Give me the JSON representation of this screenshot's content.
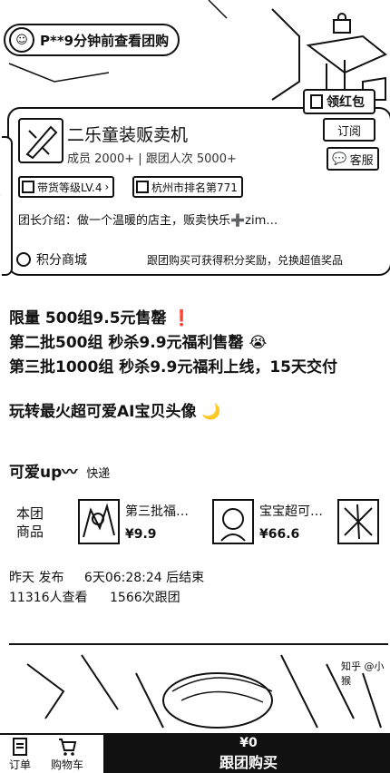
{
  "banner": {
    "notice": "P**9分钟前查看团购"
  },
  "shop": {
    "red_packet": "领红包",
    "name": "二乐童装贩卖机",
    "stats": "成员 2000+ | 跟团人次 5000+",
    "follow": "订阅",
    "service": "客服",
    "badge_level": "带货等级LV.4",
    "badge_rank": "杭州市排名第771",
    "intro": "团长介绍：做一个温暖的店主，贩卖快乐➕zim…",
    "mall": "积分商城",
    "mall_tip": "跟团购买可获得积分奖励，兑换超值奖品"
  },
  "post": {
    "line1": "限量 500组9.5元售罄 ❗",
    "line2": "第二批500组 秒杀9.9元福利售罄 😭",
    "line3": "第三批1000组 秒杀9.9元福利上线，15天交付",
    "line4": "玩转最火超可爱AI宝贝头像 🌙"
  },
  "topic": {
    "title": "可爱up〰",
    "delivery": "快递"
  },
  "products": {
    "label_line1": "本团",
    "label_line2": "商品",
    "items": [
      {
        "title": "第三批福…",
        "price": "¥9.9"
      },
      {
        "title": "宝宝超可…",
        "price": "¥66.6"
      }
    ]
  },
  "meta": {
    "published": "昨天 发布",
    "countdown": "6天06:28:24 后结束",
    "views": "11316人查看",
    "follows": "1566次跟团"
  },
  "bottom": {
    "orders": "订单",
    "cart": "购物车",
    "buy_price": "¥0",
    "buy_label": "跟团购买"
  },
  "watermark": "知乎 @小猴"
}
